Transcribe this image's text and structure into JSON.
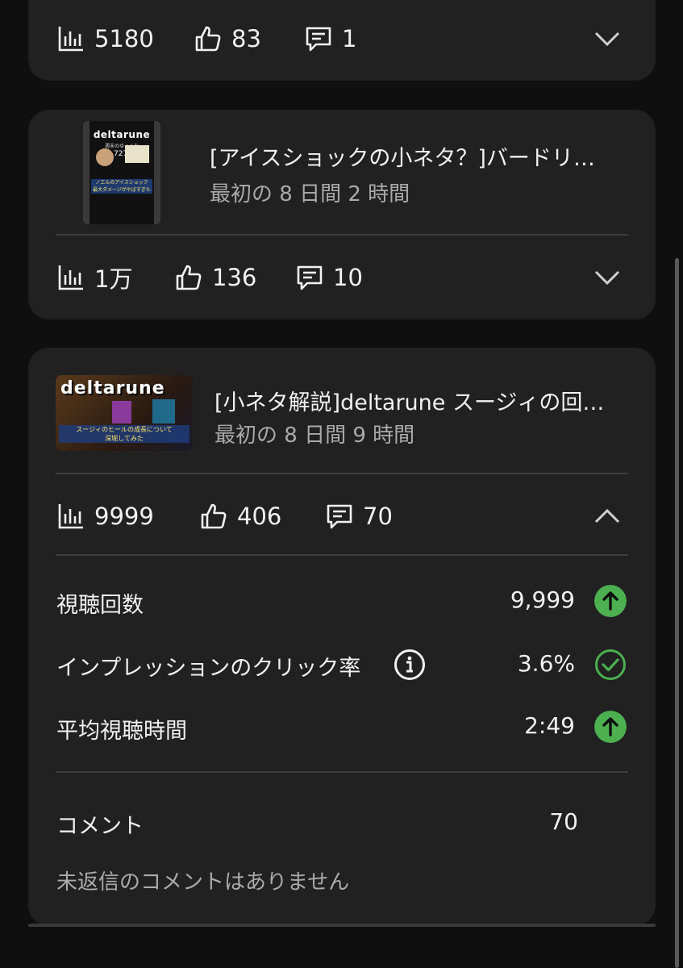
{
  "cards": [
    {
      "stats": {
        "views": "5180",
        "likes": "83",
        "comments": "1"
      },
      "expanded": false
    },
    {
      "title": "[アイスショックの小ネタ？]バードリ…",
      "subtitle": "最初の 8 日間 2 時間",
      "thumbnail": {
        "logo": "deltarune",
        "caption_top": "週末のゆっくり",
        "caption_mid": "727",
        "caption_bottom": "ノエルのアイスショック\n最大ダメージがやばすぎた"
      },
      "stats": {
        "views": "1万",
        "likes": "136",
        "comments": "10"
      },
      "expanded": false
    },
    {
      "title": "[小ネタ解説]deltarune スージィの回…",
      "subtitle": "最初の 8 日間 9 時間",
      "thumbnail": {
        "logo": "deltarune",
        "caption": "スージィのヒールの成長について\n深堀してみた"
      },
      "stats": {
        "views": "9999",
        "likes": "406",
        "comments": "70"
      },
      "expanded": true,
      "metrics": [
        {
          "label": "視聴回数",
          "value": "9,999",
          "status": "up"
        },
        {
          "label": "インプレッションのクリック率",
          "value": "3.6%",
          "status": "ok",
          "info": true
        },
        {
          "label": "平均視聴時間",
          "value": "2:49",
          "status": "up"
        }
      ],
      "comments_section": {
        "label": "コメント",
        "count": "70",
        "empty_message": "未返信のコメントはありません"
      }
    }
  ],
  "colors": {
    "card_bg": "#212121",
    "page_bg": "#0f0f0f",
    "positive": "#4caf50",
    "muted": "#aaaaaa"
  },
  "icons": {
    "views": "bar-chart-icon",
    "likes": "thumbs-up-icon",
    "comments": "comment-icon",
    "expand": "chevron-down-icon",
    "collapse": "chevron-up-icon",
    "info": "info-icon",
    "up": "arrow-up-icon",
    "ok": "check-circle-icon"
  }
}
